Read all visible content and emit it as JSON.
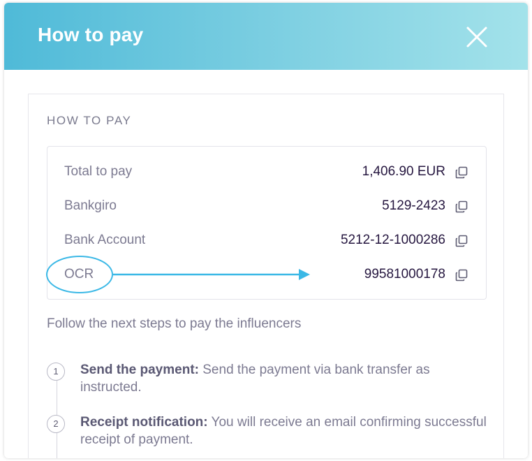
{
  "header": {
    "title": "How to pay",
    "close_icon": "close-icon",
    "gradient": [
      "#4fbad8",
      "#a3e2ea"
    ]
  },
  "card": {
    "section_title": "HOW TO PAY",
    "rows": [
      {
        "label": "Total to pay",
        "value": "1,406.90 EUR",
        "icon": "copy-icon"
      },
      {
        "label": "Bankgiro",
        "value": "5129-2423",
        "icon": "copy-icon"
      },
      {
        "label": "Bank Account",
        "value": "5212-12-1000286",
        "icon": "copy-icon"
      },
      {
        "label": "OCR",
        "value": "99581000178",
        "icon": "copy-icon"
      }
    ],
    "annotation_color": "#3ab8e6",
    "instructions": "Follow the next steps to pay the influencers",
    "steps": [
      {
        "number": "1",
        "title": "Send the payment:",
        "text": " Send the payment via bank transfer as instructed."
      },
      {
        "number": "2",
        "title": "Receipt notification:",
        "text": " You will receive an email confirming successful receipt of payment."
      }
    ]
  }
}
